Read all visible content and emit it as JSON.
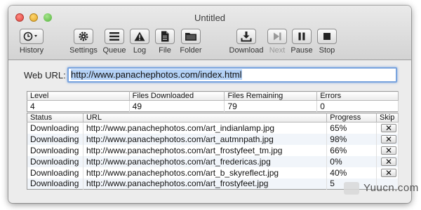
{
  "window": {
    "title": "Untitled"
  },
  "toolbar": [
    {
      "id": "history",
      "label": "History",
      "icon": "clock-icon",
      "enabled": true
    },
    {
      "id": "settings",
      "label": "Settings",
      "icon": "gear-icon",
      "enabled": true
    },
    {
      "id": "queue",
      "label": "Queue",
      "icon": "list-icon",
      "enabled": true
    },
    {
      "id": "log",
      "label": "Log",
      "icon": "warning-icon",
      "enabled": true
    },
    {
      "id": "file",
      "label": "File",
      "icon": "document-icon",
      "enabled": true
    },
    {
      "id": "folder",
      "label": "Folder",
      "icon": "folder-icon",
      "enabled": true
    },
    {
      "id": "download",
      "label": "Download",
      "icon": "download-icon",
      "enabled": true
    },
    {
      "id": "next",
      "label": "Next",
      "icon": "next-icon",
      "enabled": false
    },
    {
      "id": "pause",
      "label": "Pause",
      "icon": "pause-icon",
      "enabled": true
    },
    {
      "id": "stop",
      "label": "Stop",
      "icon": "stop-icon",
      "enabled": true
    }
  ],
  "url": {
    "label": "Web URL:",
    "value": "http://www.panachephotos.com/index.html"
  },
  "stats": {
    "headers": [
      "Level",
      "Files Downloaded",
      "Files Remaining",
      "Errors"
    ],
    "values": [
      "4",
      "49",
      "79",
      "0"
    ]
  },
  "files": {
    "headers": [
      "Status",
      "URL",
      "Progress",
      "Skip"
    ],
    "skip_glyph": "✕",
    "rows": [
      {
        "status": "Downloading",
        "url": "http://www.panachephotos.com/art_indianlamp.jpg",
        "progress": "65%"
      },
      {
        "status": "Downloading",
        "url": "http://www.panachephotos.com/art_autmnpath.jpg",
        "progress": "98%"
      },
      {
        "status": "Downloading",
        "url": "http://www.panachephotos.com/art_frostyfeet_tm.jpg",
        "progress": "66%"
      },
      {
        "status": "Downloading",
        "url": "http://www.panachephotos.com/art_fredericas.jpg",
        "progress": "0%"
      },
      {
        "status": "Downloading",
        "url": "http://www.panachephotos.com/art_b_skyreflect.jpg",
        "progress": "40%"
      },
      {
        "status": "Downloading",
        "url": "http://www.panachephotos.com/art_frostyfeet.jpg",
        "progress": "5"
      }
    ]
  },
  "watermark": {
    "text": "Yuucn.com"
  }
}
